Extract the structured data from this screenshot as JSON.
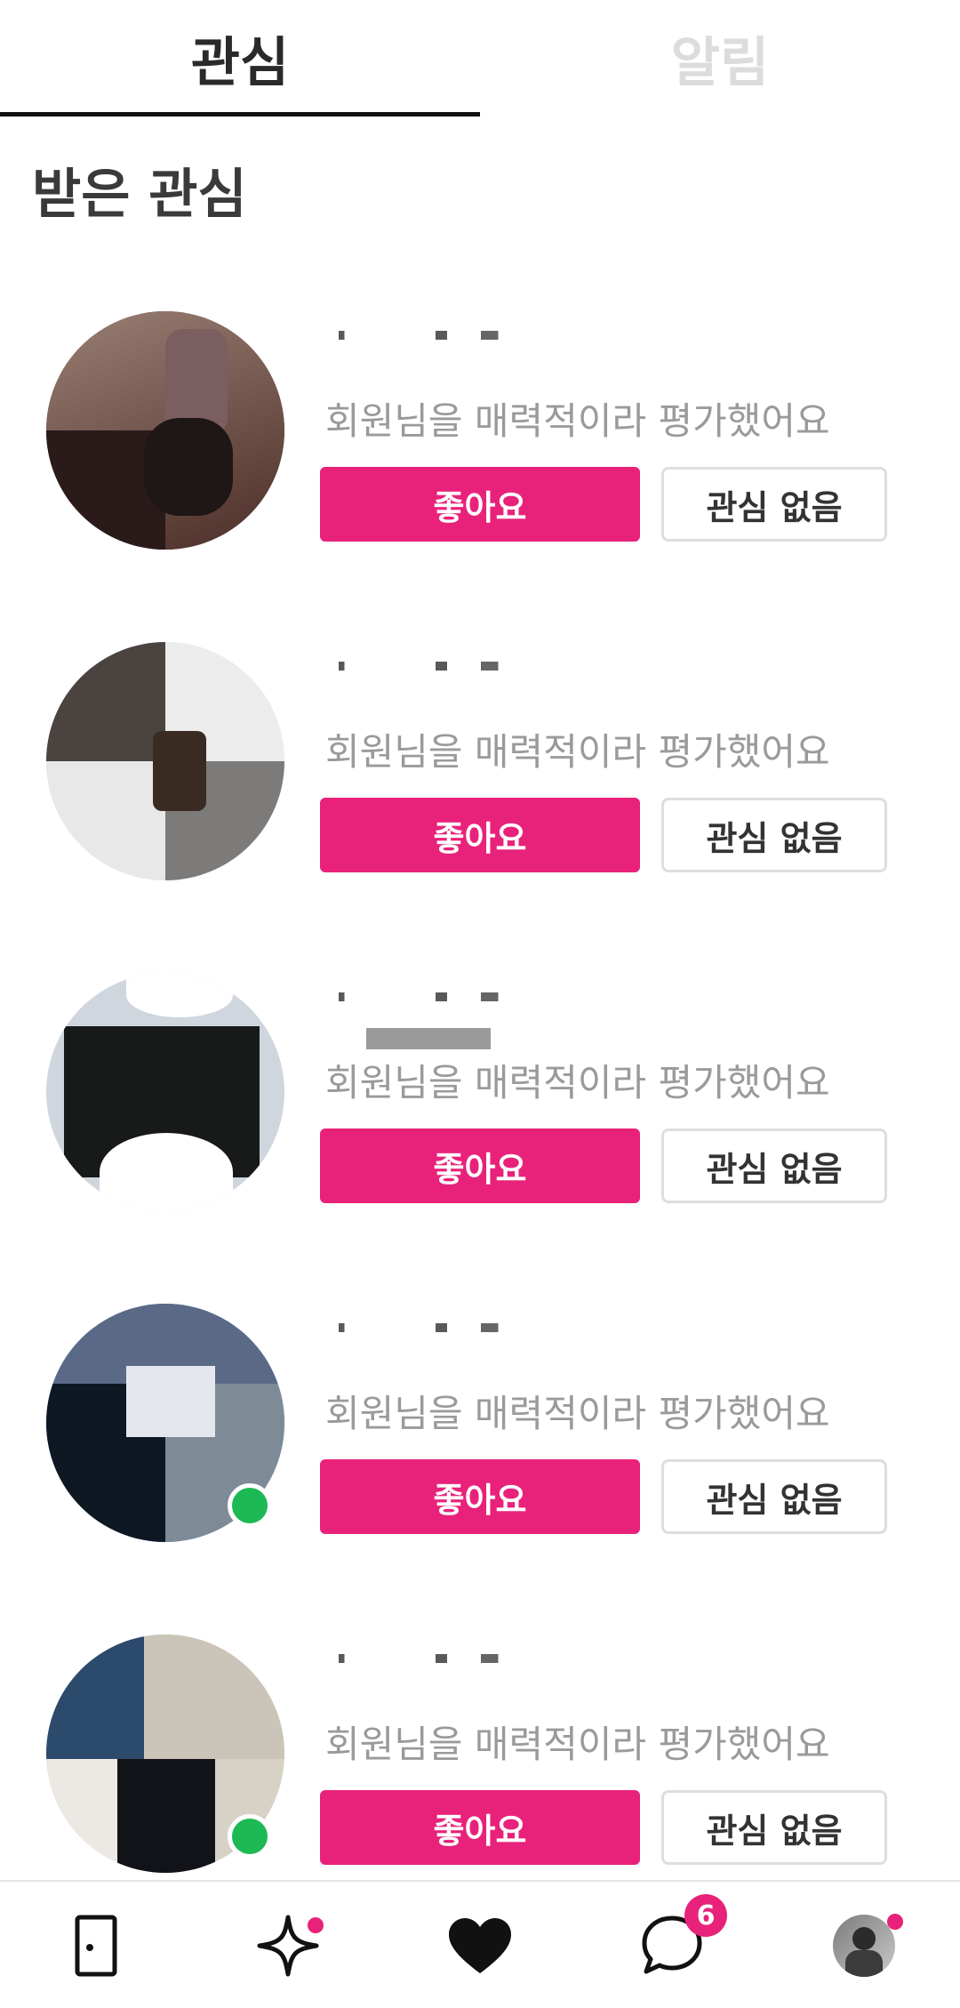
{
  "tabs": {
    "active_label": "관심",
    "inactive_label": "알림"
  },
  "section_title": "받은 관심",
  "items": [
    {
      "message": "회원님을 매력적이라 평가했어요",
      "like_label": "좋아요",
      "pass_label": "관심 없음",
      "online": false
    },
    {
      "message": "회원님을 매력적이라 평가했어요",
      "like_label": "좋아요",
      "pass_label": "관심 없음",
      "online": false
    },
    {
      "message": "회원님을 매력적이라 평가했어요",
      "like_label": "좋아요",
      "pass_label": "관심 없음",
      "online": false
    },
    {
      "message": "회원님을 매력적이라 평가했어요",
      "like_label": "좋아요",
      "pass_label": "관심 없음",
      "online": true
    },
    {
      "message": "회원님을 매력적이라 평가했어요",
      "like_label": "좋아요",
      "pass_label": "관심 없음",
      "online": true
    }
  ],
  "bottom_nav": {
    "items": [
      "door-icon",
      "sparkle-icon",
      "heart-icon",
      "chat-icon",
      "profile-avatar"
    ],
    "chat_badge_count": "6"
  },
  "colors": {
    "accent": "#e8227a",
    "online": "#1db954",
    "tab_inactive": "#dcdcdc"
  }
}
